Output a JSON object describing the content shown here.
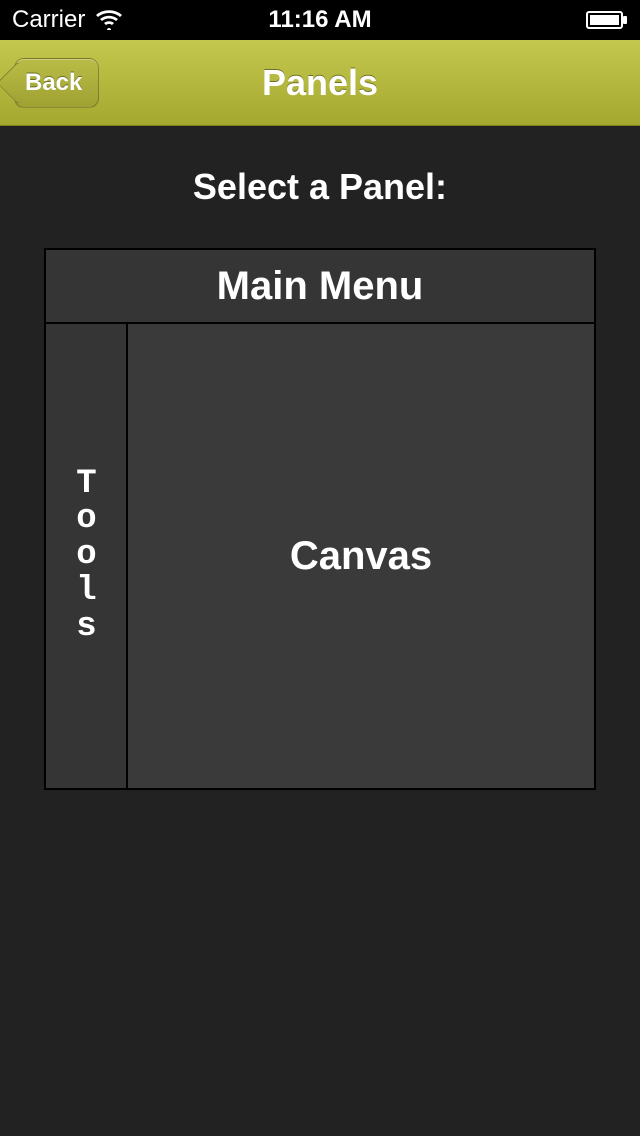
{
  "status": {
    "carrier": "Carrier",
    "time": "11:16 AM"
  },
  "nav": {
    "back_label": "Back",
    "title": "Panels"
  },
  "content": {
    "subtitle": "Select a Panel:",
    "panels": {
      "main_menu": "Main Menu",
      "tools": "Tools",
      "canvas": "Canvas"
    }
  }
}
